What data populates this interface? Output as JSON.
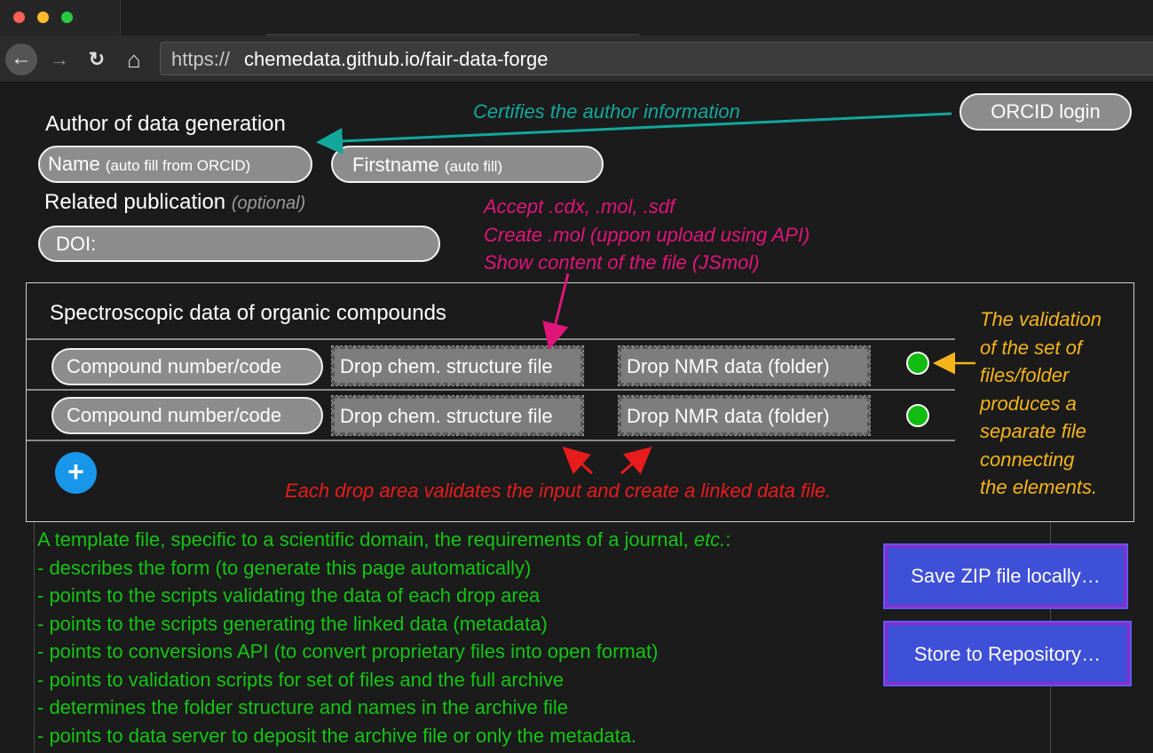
{
  "browser": {
    "url_scheme": "https://",
    "url_host": "chemedata.github.io/fair-data-forge",
    "back_icon": "←",
    "forward_icon": "→",
    "reload_icon": "↻",
    "home_icon": "⌂"
  },
  "author": {
    "heading": "Author of data generation",
    "name_label": "Name",
    "name_hint": "(auto fill from ORCID)",
    "firstname_label": "Firstname",
    "firstname_hint": "(auto fill)",
    "orcid_button": "ORCID login",
    "orcid_note": "Certifies the author information"
  },
  "publication": {
    "heading": "Related publication",
    "optional": "(optional)",
    "doi_label": "DOI:"
  },
  "structure_note": {
    "line1": "Accept .cdx, .mol, .sdf",
    "line2": "Create .mol (uppon upload using API)",
    "line3": "Show content of the file (JSmol)"
  },
  "spectro": {
    "title": "Spectroscopic data of organic compounds",
    "rows": [
      {
        "compound": "Compound number/code",
        "structure": "Drop chem. structure file",
        "nmr": "Drop NMR data (folder)"
      },
      {
        "compound": "Compound number/code",
        "structure": "Drop chem. structure file",
        "nmr": "Drop NMR data (folder)"
      }
    ],
    "add_label": "+",
    "drop_note": "Each drop area validates the input and create a linked data file."
  },
  "validation_note": [
    "The validation",
    "of the set of",
    "files/folder",
    "produces a",
    "separate file",
    "connecting",
    "the elements."
  ],
  "template_notes": {
    "intro_a": "A template file, specific to a scientific domain, the requirements of a journal, ",
    "intro_etc": "etc.",
    "intro_colon": ":",
    "items": [
      "- describes the form (to generate this page automatically)",
      "- points to the scripts validating the data of each drop area",
      "- points to the scripts generating the linked data (metadata)",
      "- points to conversions API (to convert proprietary files into open format)",
      "- points to validation scripts for set of files and the full archive",
      "- determines the folder structure and names in the archive file",
      "- points to data server to deposit the archive file or only the metadata."
    ]
  },
  "actions": {
    "save_zip": "Save ZIP file locally…",
    "store_repo": "Store to Repository…"
  },
  "colors": {
    "teal": "#13a79c",
    "pink": "#e0157a",
    "orange": "#f5b41a",
    "red": "#e81c1c",
    "green": "#14c414",
    "button_blue": "#3e4fd8"
  }
}
